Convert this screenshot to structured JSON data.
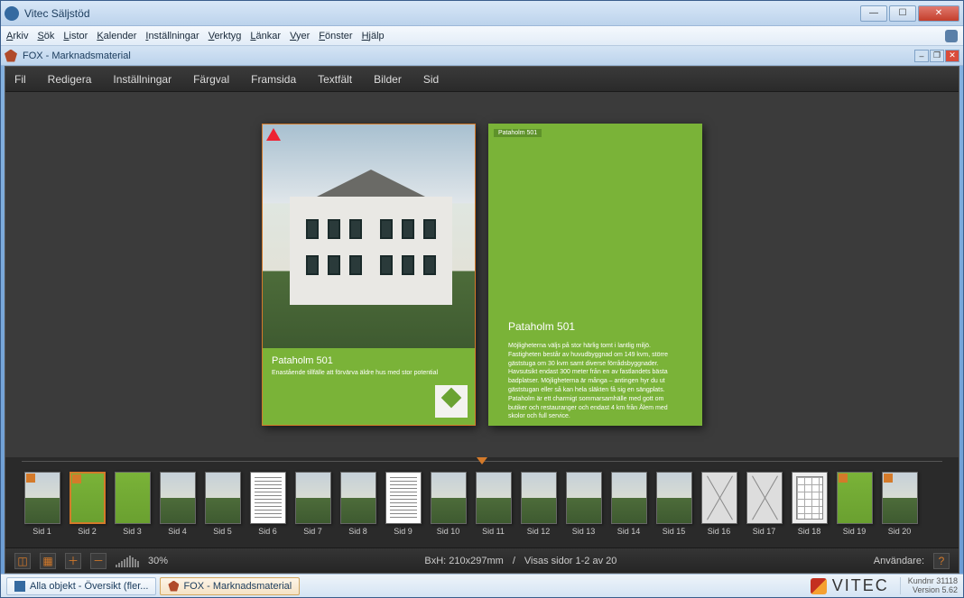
{
  "window": {
    "title": "Vitec Säljstöd"
  },
  "outer_menu": [
    "Arkiv",
    "Sök",
    "Listor",
    "Kalender",
    "Inställningar",
    "Verktyg",
    "Länkar",
    "Vyer",
    "Fönster",
    "Hjälp"
  ],
  "subdoc": {
    "title": "FOX - Marknadsmaterial"
  },
  "dark_menu": [
    "Fil",
    "Redigera",
    "Inställningar",
    "Färgval",
    "Framsida",
    "Textfält",
    "Bilder",
    "Sid"
  ],
  "page1": {
    "title": "Pataholm 501",
    "subtitle": "Enastående tillfälle att förvärva äldre hus med stor potential"
  },
  "page2": {
    "tab": "Pataholm 501",
    "title": "Pataholm 501",
    "desc": "Möjligheterna väljs på stor härlig tomt i lantlig miljö. Fastigheten består av huvudbyggnad om 149 kvm, större gäststuga om 30 kvm samt diverse förrådsbyggnader. Havsutsikt endast 300 meter från en av fastlandets bästa badplatser. Möjligheterna är många – antingen hyr du ut gäststugan eller så kan hela släkten få sig en sängplats. Pataholm är ett charmigt sommarsamhälle med gott om butiker och restauranger och endast 4 km från Ålem med skolor och full service."
  },
  "thumbs": [
    {
      "label": "Sid 1",
      "cls": "ph",
      "badge": true
    },
    {
      "label": "Sid 2",
      "cls": "g sel",
      "badge": true
    },
    {
      "label": "Sid 3",
      "cls": "g",
      "badge": false
    },
    {
      "label": "Sid 4",
      "cls": "ph",
      "badge": false
    },
    {
      "label": "Sid 5",
      "cls": "ph",
      "badge": false
    },
    {
      "label": "Sid 6",
      "cls": "tx",
      "badge": false
    },
    {
      "label": "Sid 7",
      "cls": "ph",
      "badge": false
    },
    {
      "label": "Sid 8",
      "cls": "ph",
      "badge": false
    },
    {
      "label": "Sid 9",
      "cls": "tx",
      "badge": false
    },
    {
      "label": "Sid 10",
      "cls": "ph",
      "badge": false
    },
    {
      "label": "Sid 11",
      "cls": "ph",
      "badge": false
    },
    {
      "label": "Sid 12",
      "cls": "ph",
      "badge": false
    },
    {
      "label": "Sid 13",
      "cls": "ph",
      "badge": false
    },
    {
      "label": "Sid 14",
      "cls": "ph",
      "badge": false
    },
    {
      "label": "Sid 15",
      "cls": "ph",
      "badge": false
    },
    {
      "label": "Sid 16",
      "cls": "x",
      "badge": false
    },
    {
      "label": "Sid 17",
      "cls": "x",
      "badge": false
    },
    {
      "label": "Sid 18",
      "cls": "pl",
      "badge": false
    },
    {
      "label": "Sid 19",
      "cls": "g",
      "badge": true
    },
    {
      "label": "Sid 20",
      "cls": "ph",
      "badge": true
    }
  ],
  "toolbar": {
    "zoom_pct": "30%",
    "dims": "BxH: 210x297mm",
    "pages": "Visas sidor 1-2 av 20",
    "user_label": "Användare:"
  },
  "taskbar": {
    "tabs": [
      {
        "label": "Alla objekt - Översikt (fler...",
        "active": false
      },
      {
        "label": "FOX - Marknadsmaterial",
        "active": true
      }
    ],
    "brand": "VITEC",
    "kundnr": "Kundnr 31118",
    "version": "Version 5.62"
  }
}
